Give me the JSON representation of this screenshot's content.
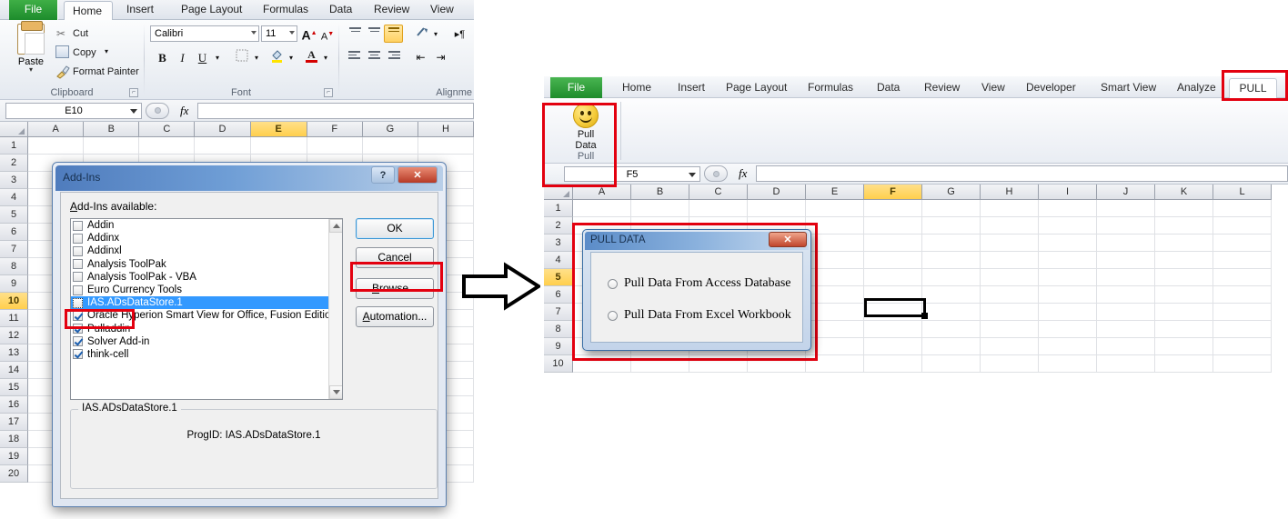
{
  "left_excel": {
    "ribbon_tabs": [
      "File",
      "Home",
      "Insert",
      "Page Layout",
      "Formulas",
      "Data",
      "Review",
      "View"
    ],
    "active_tab": "Home",
    "clipboard": {
      "paste_label": "Paste",
      "cut_label": "Cut",
      "copy_label": "Copy",
      "format_painter_label": "Format Painter",
      "group_title": "Clipboard"
    },
    "font": {
      "font_name": "Calibri",
      "font_size": "11",
      "group_title": "Font",
      "bold": "B",
      "italic": "I",
      "underline": "U",
      "grow_font": "A",
      "shrink_font": "A"
    },
    "alignment": {
      "group_title": "Alignme"
    },
    "formula_bar": {
      "name_box": "E10",
      "fx_label": "fx",
      "value": ""
    },
    "columns": [
      "A",
      "B",
      "C",
      "D",
      "E",
      "F",
      "G",
      "H"
    ],
    "selected_column": "E",
    "rows": [
      "1",
      "2",
      "3",
      "4",
      "5",
      "6",
      "7",
      "8",
      "9",
      "10",
      "11",
      "12",
      "13",
      "14",
      "15",
      "16",
      "17",
      "18",
      "19",
      "20"
    ],
    "selected_row": "10"
  },
  "addins_dialog": {
    "title": "Add-Ins",
    "help_button": "?",
    "close_button": "✕",
    "available_label": "Add-Ins available:",
    "items": [
      {
        "label": "Addin",
        "checked": false,
        "selected": false
      },
      {
        "label": "Addinx",
        "checked": false,
        "selected": false
      },
      {
        "label": "Addinxl",
        "checked": false,
        "selected": false
      },
      {
        "label": "Analysis ToolPak",
        "checked": false,
        "selected": false
      },
      {
        "label": "Analysis ToolPak - VBA",
        "checked": false,
        "selected": false
      },
      {
        "label": "Euro Currency Tools",
        "checked": false,
        "selected": false
      },
      {
        "label": "IAS.ADsDataStore.1",
        "checked": false,
        "selected": true
      },
      {
        "label": "Oracle Hyperion Smart View for Office, Fusion Edition",
        "checked": true,
        "selected": false
      },
      {
        "label": "Pulladdin",
        "checked": true,
        "selected": false
      },
      {
        "label": "Solver Add-in",
        "checked": true,
        "selected": false
      },
      {
        "label": "think-cell",
        "checked": true,
        "selected": false
      }
    ],
    "field_legend": "IAS.ADsDataStore.1",
    "field_text": "ProgID: IAS.ADsDataStore.1",
    "buttons": {
      "ok": "OK",
      "cancel": "Cancel",
      "browse": "Browse...",
      "automation": "Automation..."
    }
  },
  "right_excel": {
    "ribbon_tabs": [
      "File",
      "Home",
      "Insert",
      "Page Layout",
      "Formulas",
      "Data",
      "Review",
      "View",
      "Developer",
      "Smart View",
      "Analyze",
      "PULL"
    ],
    "active_tab": "PULL",
    "pull_group": {
      "button_line1": "Pull",
      "button_line2": "Data",
      "group_title": "Pull",
      "icon": "smiley-face-icon"
    },
    "formula_bar": {
      "name_box": "F5",
      "fx_label": "fx",
      "value": ""
    },
    "columns": [
      "A",
      "B",
      "C",
      "D",
      "E",
      "F",
      "G",
      "H",
      "I",
      "J",
      "K",
      "L"
    ],
    "selected_column": "F",
    "rows": [
      "1",
      "2",
      "3",
      "4",
      "5",
      "6",
      "7",
      "8",
      "9",
      "10"
    ],
    "selected_row": "5",
    "selected_cell": "F5"
  },
  "pull_data_form": {
    "title": "PULL DATA",
    "close_button": "✕",
    "options": [
      {
        "label": "Pull Data From Access Database",
        "selected": false
      },
      {
        "label": "Pull Data From Excel Workbook",
        "selected": false
      }
    ]
  },
  "annotations": {
    "arrow": "right-arrow",
    "highlight_color": "#e3000f",
    "highlights": [
      "browse-button",
      "pulladdin-item",
      "pull-ribbon-button",
      "pull-tab",
      "pull-data-form"
    ]
  }
}
